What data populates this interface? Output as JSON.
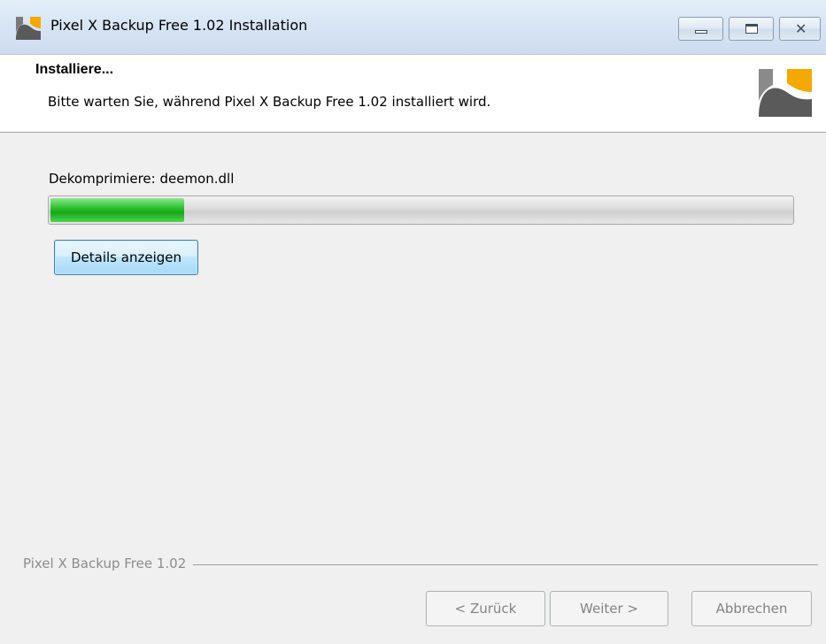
{
  "window": {
    "title": "Pixel X Backup Free 1.02 Installation",
    "minimize_glyph": "",
    "maximize_glyph": "",
    "close_glyph": "✕"
  },
  "header": {
    "title": "Installiere...",
    "subtitle": "Bitte warten Sie, während Pixel X Backup Free 1.02 installiert wird."
  },
  "body": {
    "status_text": "Dekomprimiere: deemon.dll",
    "progress_fraction": 0.18,
    "details_button": "Details anzeigen"
  },
  "footer": {
    "brand_text": "Pixel X Backup Free 1.02",
    "back_button": "< Zurück",
    "next_button": "Weiter >",
    "cancel_button": "Abbrechen"
  },
  "colors": {
    "progress_green": "#16a816",
    "logo_orange": "#f5a800",
    "logo_gray": "#5a5a5a"
  },
  "icons": {
    "app": "pixel-x-logo-icon",
    "minimize": "minimize-icon",
    "maximize": "maximize-icon",
    "close": "close-icon"
  }
}
